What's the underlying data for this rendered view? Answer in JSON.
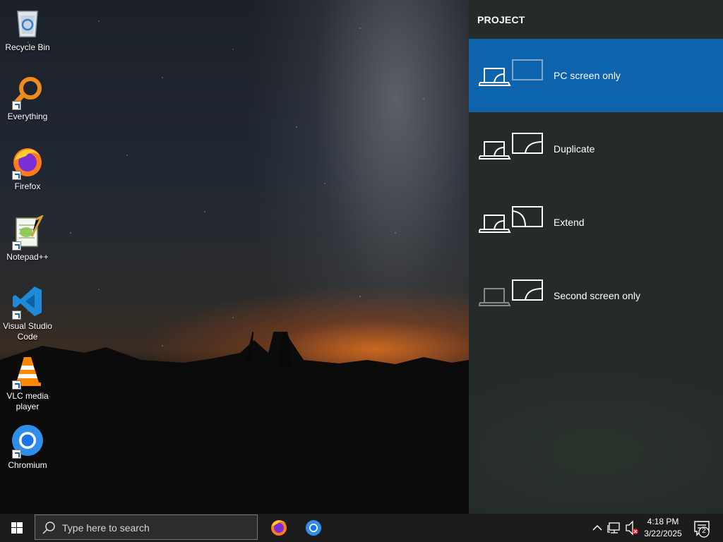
{
  "desktop": {
    "icons": [
      {
        "label": "Recycle Bin",
        "icon": "recycle-bin-icon"
      },
      {
        "label": "Everything",
        "icon": "everything-search-icon"
      },
      {
        "label": "Firefox",
        "icon": "firefox-icon"
      },
      {
        "label": "Notepad++",
        "icon": "notepadpp-icon"
      },
      {
        "label": "Visual Studio Code",
        "icon": "vscode-icon"
      },
      {
        "label": "VLC media player",
        "icon": "vlc-icon"
      },
      {
        "label": "Chromium",
        "icon": "chromium-icon"
      }
    ]
  },
  "project_panel": {
    "title": "PROJECT",
    "selected_index": 0,
    "accent_color": "#0e63ad",
    "options": [
      {
        "label": "PC screen only",
        "icon": "pc-screen-only-icon"
      },
      {
        "label": "Duplicate",
        "icon": "duplicate-display-icon"
      },
      {
        "label": "Extend",
        "icon": "extend-display-icon"
      },
      {
        "label": "Second screen only",
        "icon": "second-screen-only-icon"
      }
    ]
  },
  "taskbar": {
    "search_placeholder": "Type here to search",
    "pinned_apps": [
      "firefox-icon",
      "chromium-icon"
    ],
    "clock": {
      "time": "4:18 PM",
      "date": "3/22/2025"
    },
    "notification_count": "2",
    "tray_icons": [
      "chevron-up-icon",
      "network-icon",
      "volume-muted-icon"
    ]
  }
}
